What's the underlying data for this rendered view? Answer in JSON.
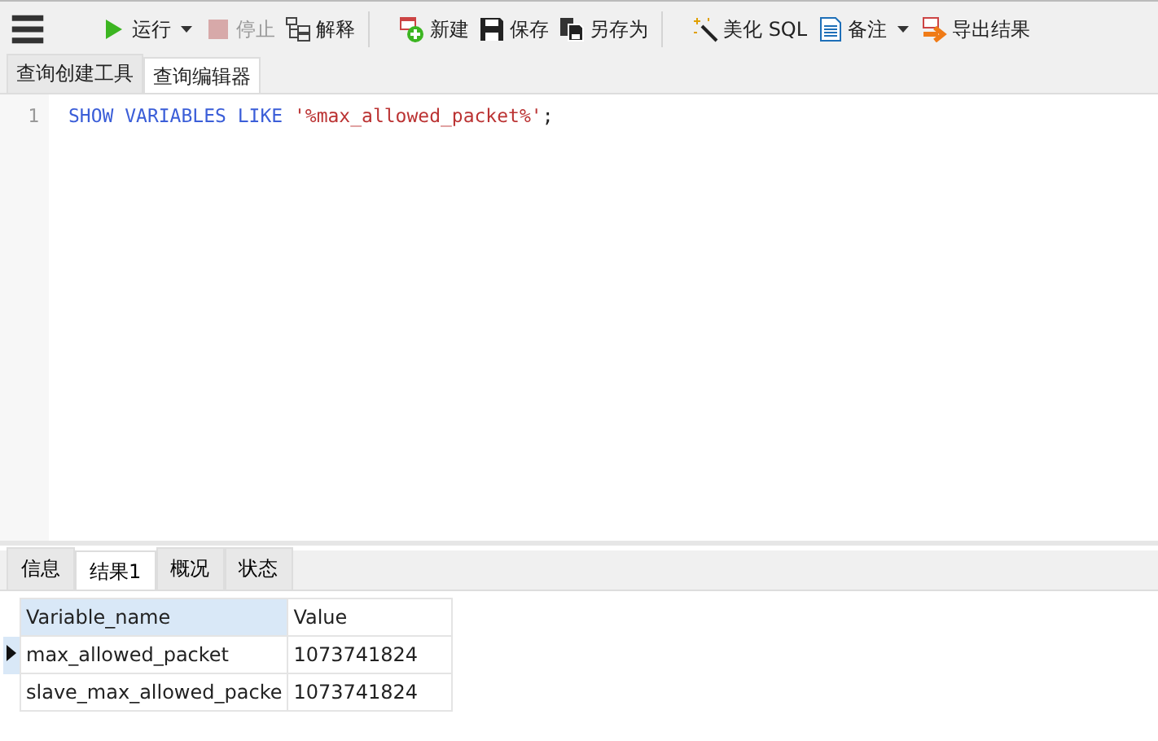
{
  "toolbar": {
    "groups": [
      [
        {
          "label": "运行",
          "dropdown": true,
          "disabled": false
        },
        {
          "label": "停止",
          "dropdown": false,
          "disabled": true
        },
        {
          "label": "解释",
          "dropdown": false,
          "disabled": false
        }
      ],
      [
        {
          "label": "新建",
          "dropdown": false,
          "disabled": false
        },
        {
          "label": "保存",
          "dropdown": false,
          "disabled": false
        },
        {
          "label": "另存为",
          "dropdown": false,
          "disabled": false
        }
      ],
      [
        {
          "label": "美化 SQL",
          "dropdown": false,
          "disabled": false
        },
        {
          "label": "备注",
          "dropdown": true,
          "disabled": false
        },
        {
          "label": "导出结果",
          "dropdown": false,
          "disabled": false
        }
      ]
    ]
  },
  "editor_tabs": [
    {
      "label": "查询创建工具",
      "selected": false
    },
    {
      "label": "查询编辑器",
      "selected": true
    }
  ],
  "editor": {
    "lines": [
      {
        "number": "1",
        "tokens": [
          {
            "kind": "keyword",
            "text": "SHOW VARIABLES LIKE "
          },
          {
            "kind": "string",
            "text": "'%max_allowed_packet%'"
          },
          {
            "kind": "plain",
            "text": ";"
          }
        ]
      }
    ]
  },
  "result_tabs": [
    {
      "label": "信息",
      "selected": false
    },
    {
      "label": "结果1",
      "selected": true
    },
    {
      "label": "概况",
      "selected": false
    },
    {
      "label": "状态",
      "selected": false
    }
  ],
  "table": {
    "columns": [
      {
        "label": "Variable_name",
        "selected": true
      },
      {
        "label": "Value",
        "selected": false
      }
    ],
    "rows": [
      {
        "current": true,
        "cells": [
          "max_allowed_packet",
          "1073741824"
        ]
      },
      {
        "current": false,
        "cells": [
          "slave_max_allowed_packe",
          "1073741824"
        ]
      }
    ]
  }
}
